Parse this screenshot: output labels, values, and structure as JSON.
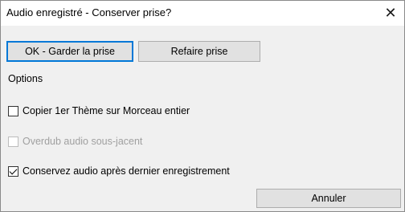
{
  "window": {
    "title": "Audio enregistré - Conserver prise?",
    "close_glyph": "✕",
    "close_icon": "close-icon"
  },
  "buttons": {
    "ok_label": "OK - Garder la prise",
    "redo_label": "Refaire prise",
    "cancel_label": "Annuler"
  },
  "options": {
    "heading": "Options",
    "items": [
      {
        "label": "Copier 1er Thème sur Morceau entier",
        "checked": false,
        "enabled": true
      },
      {
        "label": "Overdub audio sous-jacent",
        "checked": false,
        "enabled": false
      },
      {
        "label": "Conservez audio après dernier enregistrement",
        "checked": true,
        "enabled": true
      }
    ]
  },
  "colors": {
    "default_button_border": "#0078d7",
    "dialog_bg": "#f0f0f0",
    "disabled_text": "#a0a0a0"
  }
}
